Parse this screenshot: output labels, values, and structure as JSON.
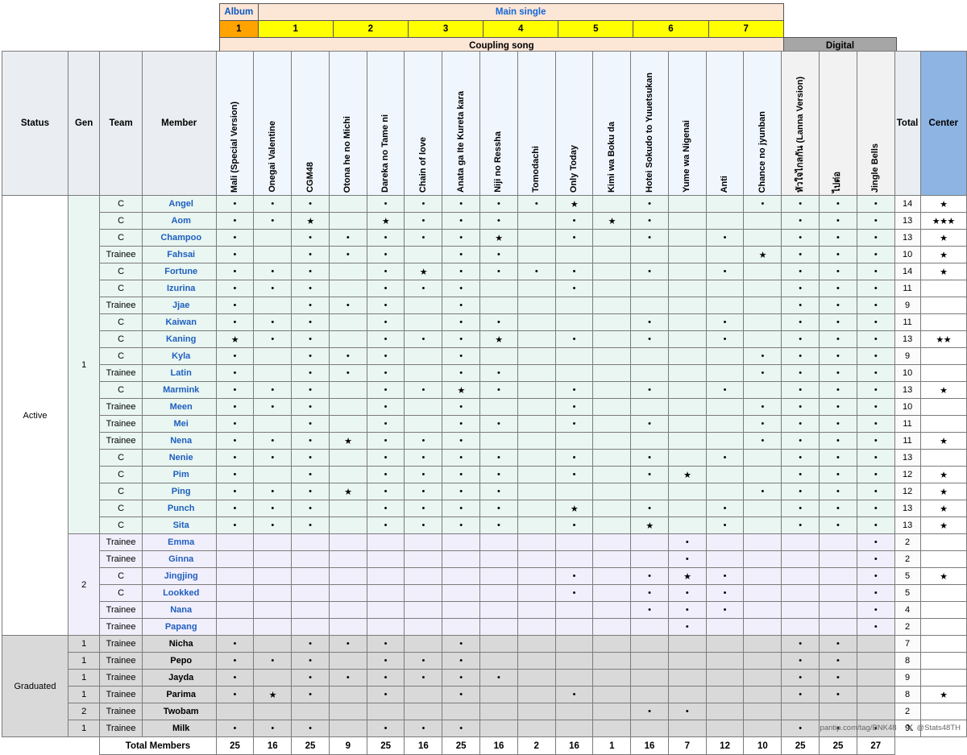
{
  "top_band": {
    "album_label": "Album",
    "main_single_label": "Main single",
    "coupling_label": "Coupling song",
    "digital_label": "Digital",
    "album_number": "1",
    "single_numbers": [
      "1",
      "2",
      "3",
      "4",
      "5",
      "6",
      "7"
    ]
  },
  "columns": {
    "status": "Status",
    "gen": "Gen",
    "team": "Team",
    "member": "Member",
    "total": "Total",
    "center": "Center",
    "songs": [
      "Mali (Special Version)",
      "Onegai Valentine",
      "CGM48",
      "Otona he no Michi",
      "Dareka no Tame ni",
      "Chain of love",
      "Anata ga Ite Kureta kara",
      "Niji no Ressha",
      "Tomodachi",
      "Only Today",
      "Kimi wa Boku da",
      "Hotei Sokudo to Yuuetsukan",
      "Yume wa Nigenai",
      "Anti",
      "Chance no jyunban",
      "หัวใจไกลกัน (Lanna Version)",
      "ไปต่อ",
      "Jingle Bells"
    ]
  },
  "status_groups": {
    "active": "Active",
    "graduated": "Graduated"
  },
  "total_row_label": "Total Members",
  "total_members": [
    "25",
    "16",
    "25",
    "9",
    "25",
    "16",
    "25",
    "16",
    "2",
    "16",
    "1",
    "16",
    "7",
    "12",
    "10",
    "25",
    "25",
    "27"
  ],
  "footer": {
    "source": "pantip.com/tag/BNK48",
    "handle": "@Stats48TH",
    "logo": "x-logo"
  },
  "rows": [
    {
      "status": "Active",
      "gen": "1",
      "team": "C",
      "member": "Angel",
      "cells": [
        "•",
        "•",
        "•",
        "",
        "•",
        "•",
        "•",
        "•",
        "•",
        "★",
        "",
        "•",
        "",
        "",
        "•",
        "•",
        "•",
        "•"
      ],
      "total": "14",
      "center": "★"
    },
    {
      "status": "Active",
      "gen": "1",
      "team": "C",
      "member": "Aom",
      "cells": [
        "•",
        "•",
        "★",
        "",
        "★",
        "•",
        "•",
        "•",
        "",
        "•",
        "★",
        "•",
        "",
        "",
        "",
        "•",
        "•",
        "•"
      ],
      "total": "13",
      "center": "★★★"
    },
    {
      "status": "Active",
      "gen": "1",
      "team": "C",
      "member": "Champoo",
      "cells": [
        "•",
        "",
        "•",
        "•",
        "•",
        "•",
        "•",
        "★",
        "",
        "•",
        "",
        "•",
        "",
        "•",
        "",
        "•",
        "•",
        "•"
      ],
      "total": "13",
      "center": "★"
    },
    {
      "status": "Active",
      "gen": "1",
      "team": "Trainee",
      "member": "Fahsai",
      "cells": [
        "•",
        "",
        "•",
        "•",
        "•",
        "",
        "•",
        "•",
        "",
        "",
        "",
        "",
        "",
        "",
        "★",
        "•",
        "•",
        "•"
      ],
      "total": "10",
      "center": "★"
    },
    {
      "status": "Active",
      "gen": "1",
      "team": "C",
      "member": "Fortune",
      "cells": [
        "•",
        "•",
        "•",
        "",
        "•",
        "★",
        "•",
        "•",
        "•",
        "•",
        "",
        "•",
        "",
        "•",
        "",
        "•",
        "•",
        "•"
      ],
      "total": "14",
      "center": "★"
    },
    {
      "status": "Active",
      "gen": "1",
      "team": "C",
      "member": "Izurina",
      "cells": [
        "•",
        "•",
        "•",
        "",
        "•",
        "•",
        "•",
        "",
        "",
        "•",
        "",
        "",
        "",
        "",
        "",
        "•",
        "•",
        "•"
      ],
      "total": "11",
      "center": ""
    },
    {
      "status": "Active",
      "gen": "1",
      "team": "Trainee",
      "member": "Jjae",
      "cells": [
        "•",
        "",
        "•",
        "•",
        "•",
        "",
        "•",
        "",
        "",
        "",
        "",
        "",
        "",
        "",
        "",
        "•",
        "•",
        "•"
      ],
      "total": "9",
      "center": ""
    },
    {
      "status": "Active",
      "gen": "1",
      "team": "C",
      "member": "Kaiwan",
      "cells": [
        "•",
        "•",
        "•",
        "",
        "•",
        "",
        "•",
        "•",
        "",
        "",
        "",
        "•",
        "",
        "•",
        "",
        "•",
        "•",
        "•"
      ],
      "total": "11",
      "center": ""
    },
    {
      "status": "Active",
      "gen": "1",
      "team": "C",
      "member": "Kaning",
      "cells": [
        "★",
        "•",
        "•",
        "",
        "•",
        "•",
        "•",
        "★",
        "",
        "•",
        "",
        "•",
        "",
        "•",
        "",
        "•",
        "•",
        "•"
      ],
      "total": "13",
      "center": "★★"
    },
    {
      "status": "Active",
      "gen": "1",
      "team": "C",
      "member": "Kyla",
      "cells": [
        "•",
        "",
        "•",
        "•",
        "•",
        "",
        "•",
        "",
        "",
        "",
        "",
        "",
        "",
        "",
        "•",
        "•",
        "•",
        "•"
      ],
      "total": "9",
      "center": ""
    },
    {
      "status": "Active",
      "gen": "1",
      "team": "Trainee",
      "member": "Latin",
      "cells": [
        "•",
        "",
        "•",
        "•",
        "•",
        "",
        "•",
        "•",
        "",
        "",
        "",
        "",
        "",
        "",
        "•",
        "•",
        "•",
        "•"
      ],
      "total": "10",
      "center": ""
    },
    {
      "status": "Active",
      "gen": "1",
      "team": "C",
      "member": "Marmink",
      "cells": [
        "•",
        "•",
        "•",
        "",
        "•",
        "•",
        "★",
        "•",
        "",
        "•",
        "",
        "•",
        "",
        "•",
        "",
        "•",
        "•",
        "•"
      ],
      "total": "13",
      "center": "★"
    },
    {
      "status": "Active",
      "gen": "1",
      "team": "Trainee",
      "member": "Meen",
      "cells": [
        "•",
        "•",
        "•",
        "",
        "•",
        "",
        "•",
        "",
        "",
        "•",
        "",
        "",
        "",
        "",
        "•",
        "•",
        "•",
        "•"
      ],
      "total": "10",
      "center": ""
    },
    {
      "status": "Active",
      "gen": "1",
      "team": "Trainee",
      "member": "Mei",
      "cells": [
        "•",
        "",
        "•",
        "",
        "•",
        "",
        "•",
        "•",
        "",
        "•",
        "",
        "•",
        "",
        "",
        "•",
        "•",
        "•",
        "•"
      ],
      "total": "11",
      "center": ""
    },
    {
      "status": "Active",
      "gen": "1",
      "team": "Trainee",
      "member": "Nena",
      "cells": [
        "•",
        "•",
        "•",
        "★",
        "•",
        "•",
        "•",
        "",
        "",
        "",
        "",
        "",
        "",
        "",
        "•",
        "•",
        "•",
        "•"
      ],
      "total": "11",
      "center": "★"
    },
    {
      "status": "Active",
      "gen": "1",
      "team": "C",
      "member": "Nenie",
      "cells": [
        "•",
        "•",
        "•",
        "",
        "•",
        "•",
        "•",
        "•",
        "",
        "•",
        "",
        "•",
        "",
        "•",
        "",
        "•",
        "•",
        "•"
      ],
      "total": "13",
      "center": ""
    },
    {
      "status": "Active",
      "gen": "1",
      "team": "C",
      "member": "Pim",
      "cells": [
        "•",
        "",
        "•",
        "",
        "•",
        "•",
        "•",
        "•",
        "",
        "•",
        "",
        "•",
        "★",
        "",
        "",
        "•",
        "•",
        "•"
      ],
      "total": "12",
      "center": "★"
    },
    {
      "status": "Active",
      "gen": "1",
      "team": "C",
      "member": "Ping",
      "cells": [
        "•",
        "•",
        "•",
        "★",
        "•",
        "•",
        "•",
        "•",
        "",
        "",
        "",
        "",
        "",
        "",
        "•",
        "•",
        "•",
        "•"
      ],
      "total": "12",
      "center": "★"
    },
    {
      "status": "Active",
      "gen": "1",
      "team": "C",
      "member": "Punch",
      "cells": [
        "•",
        "•",
        "•",
        "",
        "•",
        "•",
        "•",
        "•",
        "",
        "★",
        "",
        "•",
        "",
        "•",
        "",
        "•",
        "•",
        "•"
      ],
      "total": "13",
      "center": "★"
    },
    {
      "status": "Active",
      "gen": "1",
      "team": "C",
      "member": "Sita",
      "cells": [
        "•",
        "•",
        "•",
        "",
        "•",
        "•",
        "•",
        "•",
        "",
        "•",
        "",
        "★",
        "",
        "•",
        "",
        "•",
        "•",
        "•"
      ],
      "total": "13",
      "center": "★"
    },
    {
      "status": "Active",
      "gen": "2",
      "team": "Trainee",
      "member": "Emma",
      "cells": [
        "",
        "",
        "",
        "",
        "",
        "",
        "",
        "",
        "",
        "",
        "",
        "",
        "•",
        "",
        "",
        "",
        "",
        "•"
      ],
      "total": "2",
      "center": ""
    },
    {
      "status": "Active",
      "gen": "2",
      "team": "Trainee",
      "member": "Ginna",
      "cells": [
        "",
        "",
        "",
        "",
        "",
        "",
        "",
        "",
        "",
        "",
        "",
        "",
        "•",
        "",
        "",
        "",
        "",
        "•"
      ],
      "total": "2",
      "center": ""
    },
    {
      "status": "Active",
      "gen": "2",
      "team": "C",
      "member": "Jingjing",
      "cells": [
        "",
        "",
        "",
        "",
        "",
        "",
        "",
        "",
        "",
        "•",
        "",
        "•",
        "★",
        "•",
        "",
        "",
        "",
        "•"
      ],
      "total": "5",
      "center": "★"
    },
    {
      "status": "Active",
      "gen": "2",
      "team": "C",
      "member": "Lookked",
      "cells": [
        "",
        "",
        "",
        "",
        "",
        "",
        "",
        "",
        "",
        "•",
        "",
        "•",
        "•",
        "•",
        "",
        "",
        "",
        "•"
      ],
      "total": "5",
      "center": ""
    },
    {
      "status": "Active",
      "gen": "2",
      "team": "Trainee",
      "member": "Nana",
      "cells": [
        "",
        "",
        "",
        "",
        "",
        "",
        "",
        "",
        "",
        "",
        "",
        "•",
        "•",
        "•",
        "",
        "",
        "",
        "•"
      ],
      "total": "4",
      "center": ""
    },
    {
      "status": "Active",
      "gen": "2",
      "team": "Trainee",
      "member": "Papang",
      "cells": [
        "",
        "",
        "",
        "",
        "",
        "",
        "",
        "",
        "",
        "",
        "",
        "",
        "•",
        "",
        "",
        "",
        "",
        "•"
      ],
      "total": "2",
      "center": ""
    },
    {
      "status": "Graduated",
      "gen": "1",
      "team": "Trainee",
      "member": "Nicha",
      "cells": [
        "•",
        "",
        "•",
        "•",
        "•",
        "",
        "•",
        "",
        "",
        "",
        "",
        "",
        "",
        "",
        "",
        "•",
        "•",
        ""
      ],
      "total": "7",
      "center": ""
    },
    {
      "status": "Graduated",
      "gen": "1",
      "team": "Trainee",
      "member": "Pepo",
      "cells": [
        "•",
        "•",
        "•",
        "",
        "•",
        "•",
        "•",
        "",
        "",
        "",
        "",
        "",
        "",
        "",
        "",
        "•",
        "•",
        ""
      ],
      "total": "8",
      "center": ""
    },
    {
      "status": "Graduated",
      "gen": "1",
      "team": "Trainee",
      "member": "Jayda",
      "cells": [
        "•",
        "",
        "•",
        "•",
        "•",
        "•",
        "•",
        "•",
        "",
        "",
        "",
        "",
        "",
        "",
        "",
        "•",
        "•",
        ""
      ],
      "total": "9",
      "center": ""
    },
    {
      "status": "Graduated",
      "gen": "1",
      "team": "Trainee",
      "member": "Parima",
      "cells": [
        "•",
        "★",
        "•",
        "",
        "•",
        "",
        "•",
        "",
        "",
        "•",
        "",
        "",
        "",
        "",
        "",
        "•",
        "•",
        ""
      ],
      "total": "8",
      "center": "★"
    },
    {
      "status": "Graduated",
      "gen": "2",
      "team": "Trainee",
      "member": "Twobam",
      "cells": [
        "",
        "",
        "",
        "",
        "",
        "",
        "",
        "",
        "",
        "",
        "",
        "•",
        "•",
        "",
        "",
        "",
        "",
        ""
      ],
      "total": "2",
      "center": ""
    },
    {
      "status": "Graduated",
      "gen": "1",
      "team": "Trainee",
      "member": "Milk",
      "cells": [
        "•",
        "•",
        "•",
        "",
        "•",
        "•",
        "•",
        "",
        "",
        "",
        "",
        "",
        "",
        "",
        "",
        "•",
        "•",
        "•"
      ],
      "total": "9",
      "center": ""
    }
  ]
}
